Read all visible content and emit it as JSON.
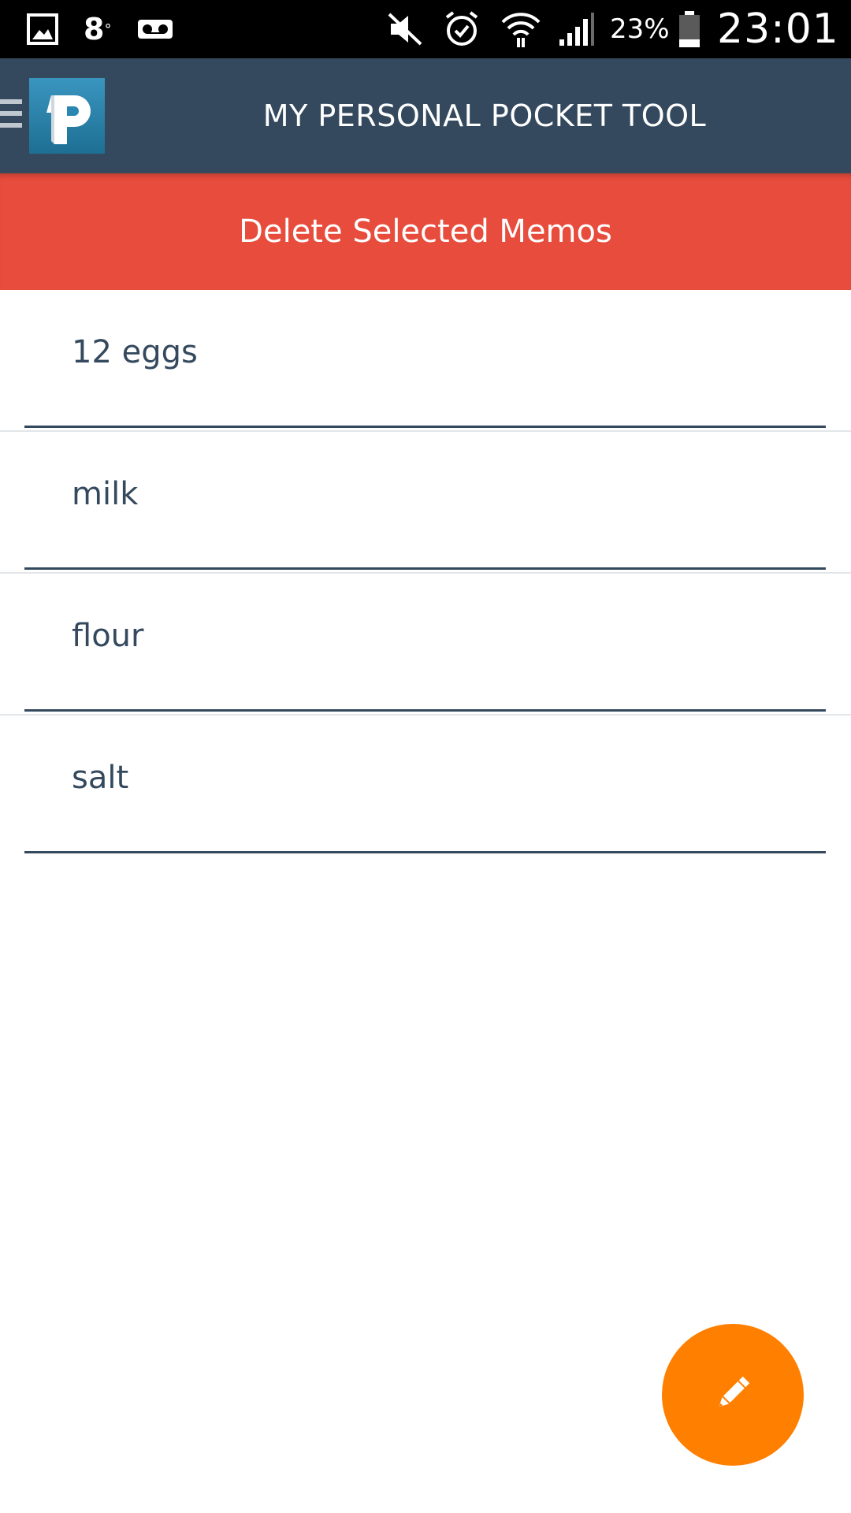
{
  "status_bar": {
    "temperature": "8",
    "temperature_unit": "°",
    "battery_percent": "23%",
    "time": "23:01",
    "icons": [
      "gallery-icon",
      "voicemail-icon",
      "mute-icon",
      "alarm-icon",
      "wifi-icon",
      "signal-icon",
      "battery-icon"
    ]
  },
  "app_bar": {
    "title": "MY PERSONAL POCKET TOOL",
    "logo_letter": "P",
    "logo_colors": [
      "#2e86ab",
      "#1b6f8f"
    ]
  },
  "actions": {
    "delete_label": "Delete Selected Memos"
  },
  "memos": [
    {
      "text": "12 eggs"
    },
    {
      "text": "milk"
    },
    {
      "text": "flour"
    },
    {
      "text": "salt"
    }
  ],
  "fab": {
    "icon": "pencil-icon"
  },
  "colors": {
    "app_bar": "#34495e",
    "delete_bar": "#e74c3c",
    "fab": "#ff7f00",
    "memo_text": "#34495e"
  }
}
